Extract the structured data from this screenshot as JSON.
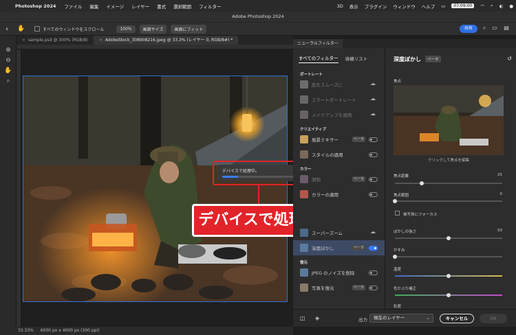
{
  "menubar": {
    "app": "Photoshop 2024",
    "items": [
      "ファイル",
      "編集",
      "イメージ",
      "レイヤー",
      "書式",
      "選択範囲",
      "フィルター"
    ],
    "right_items": [
      "3D",
      "表示",
      "プラグイン",
      "ウィンドウ",
      "ヘルプ"
    ],
    "clock": "07:09:00"
  },
  "titlebar": {
    "title": "Adobe Photoshop 2024"
  },
  "options": {
    "scroll_all": "すべてのウィンドウをスクロール",
    "zoom100": "100%",
    "fit_screen": "画面サイズ",
    "fill_screen": "画面にフィット",
    "share": "共有"
  },
  "doc_tabs": [
    {
      "label": "sample.psd @ 300% (RGB/8)"
    },
    {
      "label": "AdobeStock_308908216.jpeg @ 33.3% (レイヤー 0, RGB/8#) *"
    }
  ],
  "status": {
    "zoom": "33.33%",
    "dims": "6000 px x 4000 px (300 ppi)"
  },
  "processing": {
    "text": "デバイスで処理中。",
    "progress": 0.22
  },
  "callout": {
    "text": "デバイスで処理中"
  },
  "neural": {
    "panel_tab": "ニューラルフィルター",
    "tabs": [
      "すべてのフィルター",
      "待機リスト"
    ],
    "categories": {
      "portrait": "ポートレート",
      "creative": "クリエイティブ",
      "color": "カラー",
      "restore": "復元"
    },
    "items": {
      "smooth_skin": "肌をスムーズに",
      "smart_portrait": "スマートポートレート",
      "makeup": "メイクアップを適用",
      "landscape": "風景ミキサー",
      "style": "スタイルの適用",
      "harmonize": "調和",
      "colorize": "カラーの適用",
      "super_zoom": "スーパーズーム",
      "depth_blur": "深度ぼかし",
      "jpeg_noise": "JPEG のノイズを削除",
      "photo_restore": "写真を復元"
    },
    "beta": "ベータ"
  },
  "detail": {
    "title": "深度ぼかし",
    "beta": "ベータ",
    "focus_label": "焦点",
    "caption": "クリックして焦点を編集",
    "focal_distance": "焦点距離",
    "focal_distance_val": "25",
    "focal_range": "焦点範囲",
    "focal_range_val": "0",
    "focus_subject": "被写体にフォーカス",
    "blur_strength": "ぼかしの強さ",
    "blur_strength_val": "50",
    "haze": "かすみ",
    "temperature": "温度",
    "tint": "色かぶり補正",
    "saturation": "彩度"
  },
  "bottom": {
    "output_label": "出力",
    "output_value": "現在のレイヤー",
    "cancel": "キャンセル",
    "ok": "OK"
  },
  "colors": {
    "accent": "#2f6fe0",
    "callout": "#e2232a"
  }
}
